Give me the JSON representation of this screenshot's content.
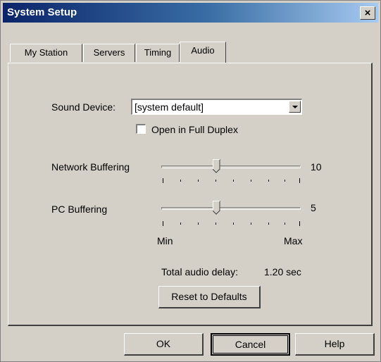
{
  "window": {
    "title": "System Setup",
    "close_label": "×"
  },
  "tabs": [
    {
      "label": "My Station",
      "active": false
    },
    {
      "label": "Servers",
      "active": false
    },
    {
      "label": "Timing",
      "active": false
    },
    {
      "label": "Audio",
      "active": true
    }
  ],
  "audio": {
    "sound_device_label": "Sound Device:",
    "sound_device_value": "[system default]",
    "full_duplex_label": "Open in Full Duplex",
    "full_duplex_checked": false,
    "network_buffering": {
      "label": "Network Buffering",
      "value": "10"
    },
    "pc_buffering": {
      "label": "PC Buffering",
      "value": "5"
    },
    "scale_min_label": "Min",
    "scale_max_label": "Max",
    "delay_label": "Total audio delay:",
    "delay_value": "1.20 sec",
    "reset_label": "Reset to Defaults"
  },
  "buttons": {
    "ok": "OK",
    "cancel": "Cancel",
    "help": "Help"
  }
}
